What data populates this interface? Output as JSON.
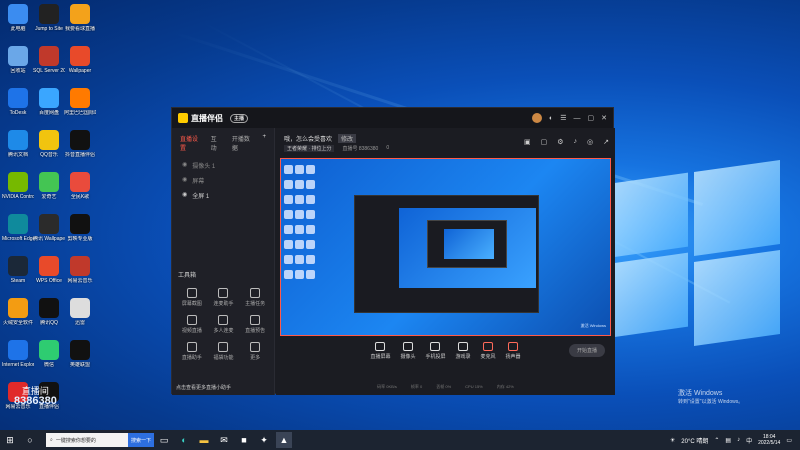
{
  "desktop": {
    "icons": [
      {
        "label": "此电脑",
        "color": "#3b8cf0"
      },
      {
        "label": "Jump to Site",
        "color": "#222"
      },
      {
        "label": "我要看球直播",
        "color": "#f3a21b"
      },
      {
        "label": "回收站",
        "color": "#6aa7e8"
      },
      {
        "label": "SQL Server 2012",
        "color": "#c0392b"
      },
      {
        "label": "Wallpaper",
        "color": "#e84a2a"
      },
      {
        "label": "ToDesk",
        "color": "#1e73e8"
      },
      {
        "label": "百度网盘",
        "color": "#3aa6ff"
      },
      {
        "label": "阿里巴巴国际站",
        "color": "#ff7a00"
      },
      {
        "label": "腾讯文档",
        "color": "#1e8ae8"
      },
      {
        "label": "QQ音乐",
        "color": "#f1c40f"
      },
      {
        "label": "抖音直播伴侣",
        "color": "#111"
      },
      {
        "label": "NVIDIA Control Panel",
        "color": "#76b900"
      },
      {
        "label": "爱奇艺",
        "color": "#44c553"
      },
      {
        "label": "全民K歌",
        "color": "#e94b3c"
      },
      {
        "label": "Microsoft Edge",
        "color": "#0f8a9c"
      },
      {
        "label": "腾讯 Wallpaper",
        "color": "#2b2b2b"
      },
      {
        "label": "剪映专业版",
        "color": "#111"
      },
      {
        "label": "Steam",
        "color": "#1b2838"
      },
      {
        "label": "WPS Office",
        "color": "#e84a2a"
      },
      {
        "label": "网易云音乐",
        "color": "#c0392b"
      },
      {
        "label": "火绒安全软件",
        "color": "#f39c12"
      },
      {
        "label": "腾讯QQ",
        "color": "#111"
      },
      {
        "label": "迅雷",
        "color": "#ddd"
      },
      {
        "label": "Internet Explorer",
        "color": "#1e73e8"
      },
      {
        "label": "微信",
        "color": "#2ecc71"
      },
      {
        "label": "英雄联盟",
        "color": "#111"
      },
      {
        "label": "网易云音乐",
        "color": "#e02a2a"
      },
      {
        "label": "直播伴侣",
        "color": "#111"
      }
    ],
    "watermark": {
      "title": "激活 Windows",
      "subtitle": "转到\"设置\"以激活 Windows。"
    },
    "overlay": {
      "line1": "直播间",
      "line2": "8386380"
    }
  },
  "app": {
    "title": "直播伴侣",
    "badge": "主播",
    "left_tabs": [
      "直播设置",
      "互动",
      "开播数据"
    ],
    "left_rows": [
      "摄像头 1",
      "屏幕",
      "全屏 1"
    ],
    "tools_heading": "工具箱",
    "tools": [
      "屏幕截图",
      "连麦助手",
      "主播任务",
      "视频直播",
      "多人连麦",
      "直播预告",
      "直播助手",
      "福袋功能",
      "更多"
    ],
    "hint": "点击查看更多直播小助手",
    "header": {
      "title": "哦，怎么会受喜欢",
      "tag": "修改"
    },
    "meta": {
      "chip": "王者荣耀 · 排位上分",
      "uid": "直播号 8386380",
      "likes": "0"
    },
    "preview_win": "激活 Windows",
    "controls": [
      "直播屏幕",
      "摄像头",
      "手机投屏",
      "游戏录",
      "麦克风",
      "扬声器"
    ],
    "start_button": "开始直播",
    "status": [
      "码率 0KB/s",
      "帧率 0",
      "丢帧 0%",
      "CPU 15%",
      "内存 42%"
    ]
  },
  "taskbar": {
    "search_text": "一键搜索你想要的",
    "search_button": "搜索一下",
    "weather": "20°C 晴朗",
    "time": "18:04",
    "date": "2022/5/14"
  }
}
